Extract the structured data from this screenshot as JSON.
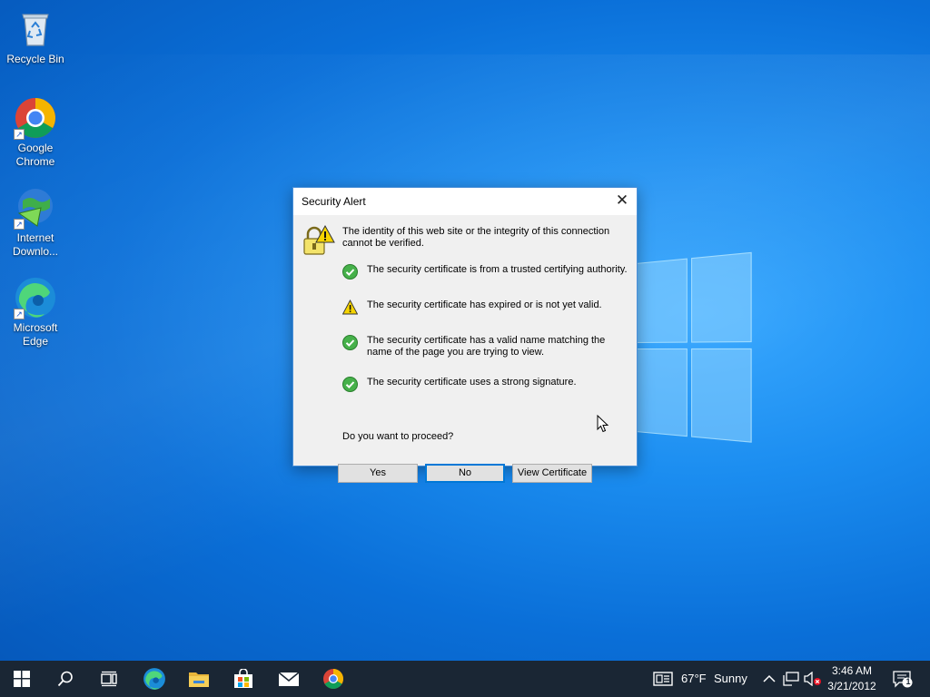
{
  "desktop": {
    "icons": [
      {
        "label": "Recycle Bin",
        "icon": "recycle-bin-icon"
      },
      {
        "label": "Google Chrome",
        "icon": "chrome-icon"
      },
      {
        "label": "Internet Downlo...",
        "icon": "internet-download-manager-icon"
      },
      {
        "label": "Microsoft Edge",
        "icon": "edge-icon"
      }
    ]
  },
  "dialog": {
    "title": "Security Alert",
    "close_label": "✕",
    "intro": "The identity of this web site or the integrity of this connection cannot be verified.",
    "checks": [
      {
        "status": "ok",
        "icon": "green-check-icon",
        "text": "The security certificate is from a trusted certifying authority."
      },
      {
        "status": "warning",
        "icon": "warning-icon",
        "text": "The security certificate has expired or is not yet valid."
      },
      {
        "status": "ok",
        "icon": "green-check-icon",
        "text": "The security certificate has a valid name matching the name of the page you are trying to view."
      },
      {
        "status": "ok",
        "icon": "green-check-icon",
        "text": "The security certificate uses a strong signature."
      }
    ],
    "question": "Do you want to proceed?",
    "buttons": {
      "yes": "Yes",
      "no": "No",
      "view_certificate": "View Certificate"
    },
    "default_button": "no"
  },
  "taskbar": {
    "pinned": [
      "start-icon",
      "search-icon",
      "task-view-icon",
      "edge-icon",
      "file-explorer-icon",
      "store-icon",
      "mail-icon",
      "chrome-icon"
    ],
    "weather": {
      "temperature": "67°F",
      "condition": "Sunny"
    },
    "clock": {
      "time": "3:46 AM",
      "date": "3/21/2012"
    },
    "notifications_count": "1"
  },
  "colors": {
    "accent": "#0078d7",
    "taskbar": "#1a2634",
    "ok": "#3aa23a",
    "warning": "#f2c200"
  }
}
